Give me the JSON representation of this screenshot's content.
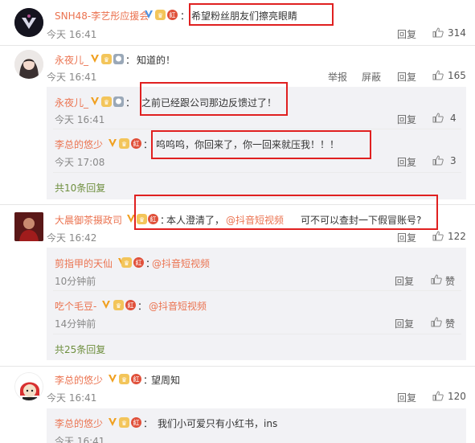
{
  "comments": [
    {
      "user": "SNH48-李艺彤应援会",
      "text": "希望粉丝朋友们擦亮眼睛",
      "time": "今天 16:41",
      "reply": "回复",
      "likes": "314"
    },
    {
      "user": "永夜儿_",
      "text": "知道的！",
      "time": "今天 16:41",
      "report": "举报",
      "block": "屏蔽",
      "reply": "回复",
      "likes": "165"
    },
    {
      "user": "永夜儿_",
      "text": "之前已经跟公司那边反馈过了！",
      "time": "今天 16:41",
      "reply": "回复",
      "likes": "4"
    },
    {
      "user": "李总的悠少",
      "text": "呜呜呜，你回来了，你一回来就压我！！！",
      "time": "今天 17:08",
      "reply": "回复",
      "likes": "3"
    },
    {
      "more": "共10条回复"
    },
    {
      "user": "大晨御茶摄政司",
      "text_before": "本人澄清了，",
      "mention": "@抖音短视频",
      "text_after": " 可不可以查封一下假冒账号?",
      "time": "今天 16:42",
      "reply": "回复",
      "likes": "122"
    },
    {
      "user": "剪指甲的天仙",
      "mention": "@抖音短视频",
      "time": "10分钟前",
      "reply": "回复",
      "likes": "赞"
    },
    {
      "user": "吃个毛豆-",
      "mention": "@抖音短视频",
      "time": "14分钟前",
      "reply": "回复",
      "likes": "赞"
    },
    {
      "more": "共25条回复"
    },
    {
      "user": "李总的悠少",
      "text": "望周知",
      "time": "今天 16:41",
      "reply": "回复",
      "likes": "120"
    },
    {
      "user": "李总的悠少",
      "text": "我们小可爱只有小红书，ins",
      "time": "今天 16:41"
    }
  ]
}
